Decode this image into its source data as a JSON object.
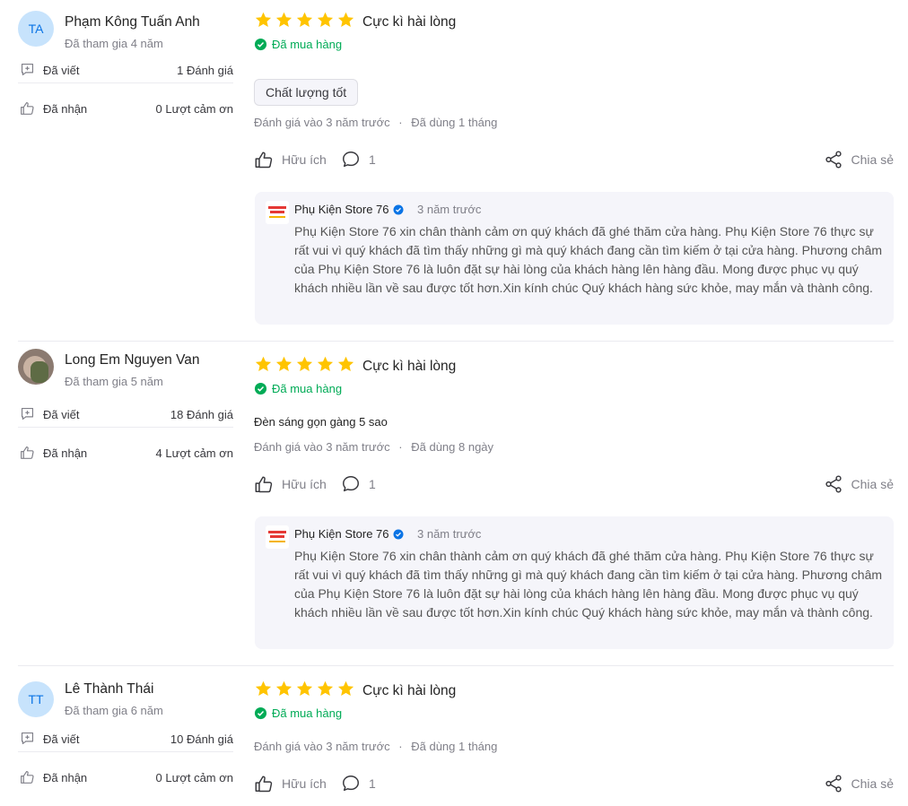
{
  "icons": {
    "star": "star-icon",
    "verified": "check-circle-icon",
    "written": "comment-plus-icon",
    "received": "thumb-up-icon",
    "helpful": "thumb-up-icon",
    "reply_count": "speech-bubble-icon",
    "share": "share-icon",
    "seller_verified": "verified-badge-icon"
  },
  "colors": {
    "star": "#ffc400",
    "verified": "#00ab56",
    "avatar_bg": "#c7e3fc",
    "avatar_text": "#0b74e5",
    "reply_bg": "#f5f5fa"
  },
  "labels": {
    "written": "Đã viết",
    "received": "Đã nhận",
    "helpful": "Hữu ích",
    "share": "Chia sẻ",
    "bought": "Đã mua hàng"
  },
  "seller": {
    "name": "Phụ Kiện Store 76",
    "logo_text": "PHỤ KIỆN STORE 76"
  },
  "reviews": [
    {
      "initials": "TA",
      "name": "Phạm Kông Tuấn Anh",
      "joined": "Đã tham gia 4 năm",
      "written_count": "1 Đánh giá",
      "received_count": "0 Lượt cảm ơn",
      "rating": 5,
      "rating_text": "Cực kì hài lòng",
      "chip": "Chất lượng tốt",
      "comment": "",
      "meta_posted": "Đánh giá vào 3 năm trước",
      "meta_used": "Đã dùng 1 tháng",
      "reply_count": "1",
      "reply": {
        "time": "3 năm trước",
        "text": "Phụ Kiện Store 76 xin chân thành cảm ơn quý khách đã ghé thăm cửa hàng. Phụ Kiện Store 76 thực sự rất vui vì quý khách đã tìm thấy những gì mà quý khách đang cần tìm kiếm ở tại cửa hàng. Phương châm của Phụ Kiện Store 76 là luôn đặt sự hài lòng của khách hàng lên hàng đầu. Mong được phục vụ quý khách nhiều lần về sau được tốt hơn.Xin kính chúc Quý khách hàng sức khỏe, may mắn và thành công."
      }
    },
    {
      "initials": "",
      "name": "Long Em Nguyen Van",
      "joined": "Đã tham gia 5 năm",
      "written_count": "18 Đánh giá",
      "received_count": "4 Lượt cảm ơn",
      "rating": 5,
      "rating_text": "Cực kì hài lòng",
      "chip": "",
      "comment": "Đèn sáng gọn gàng 5 sao",
      "meta_posted": "Đánh giá vào 3 năm trước",
      "meta_used": "Đã dùng 8 ngày",
      "reply_count": "1",
      "reply": {
        "time": "3 năm trước",
        "text": "Phụ Kiện Store 76 xin chân thành cảm ơn quý khách đã ghé thăm cửa hàng. Phụ Kiện Store 76 thực sự rất vui vì quý khách đã tìm thấy những gì mà quý khách đang cần tìm kiếm ở tại cửa hàng. Phương châm của Phụ Kiện Store 76 là luôn đặt sự hài lòng của khách hàng lên hàng đầu. Mong được phục vụ quý khách nhiều lần về sau được tốt hơn.Xin kính chúc Quý khách hàng sức khỏe, may mắn và thành công."
      }
    },
    {
      "initials": "TT",
      "name": "Lê Thành Thái",
      "joined": "Đã tham gia 6 năm",
      "written_count": "10 Đánh giá",
      "received_count": "0 Lượt cảm ơn",
      "rating": 5,
      "rating_text": "Cực kì hài lòng",
      "chip": "",
      "comment": "",
      "meta_posted": "Đánh giá vào 3 năm trước",
      "meta_used": "Đã dùng 1 tháng",
      "reply_count": "1"
    }
  ]
}
